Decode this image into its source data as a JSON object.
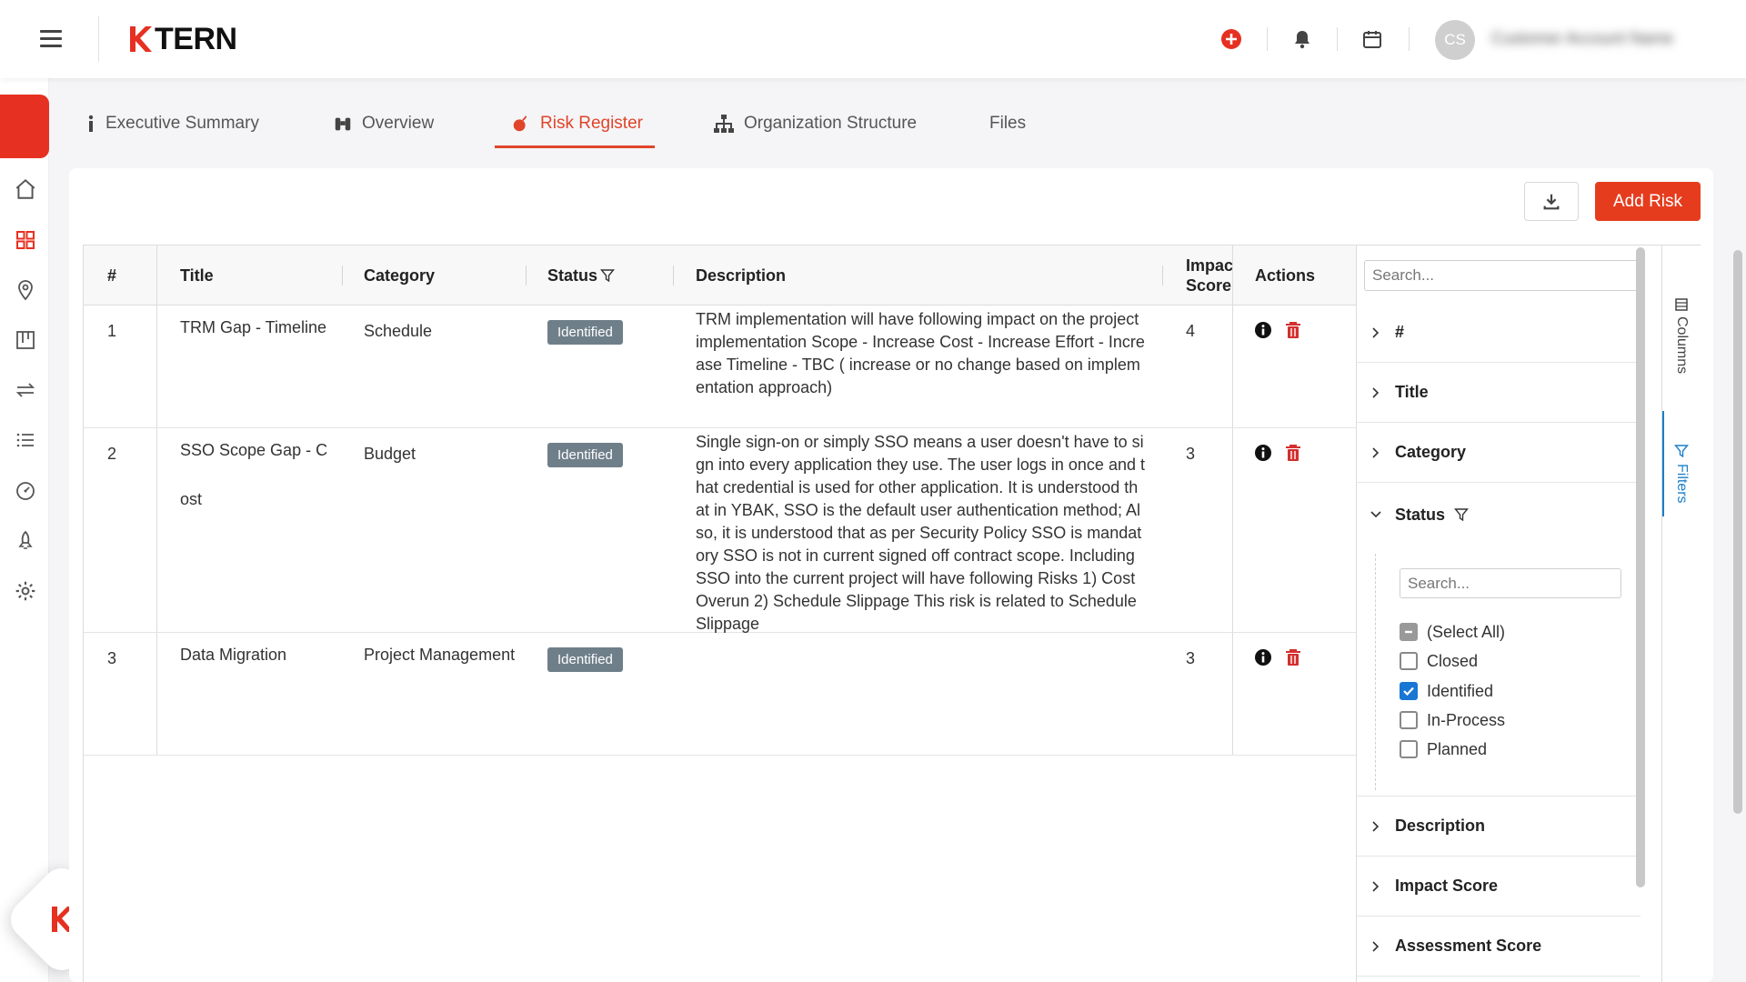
{
  "brand": {
    "name": "TERN",
    "accent": "#e63021"
  },
  "header": {
    "avatar_initials": "CS",
    "user_name": "Customer Account Name",
    "icons": [
      "add-circle-icon",
      "bell-icon",
      "calendar-icon"
    ]
  },
  "sidebar": {
    "items": [
      {
        "name": "home-icon"
      },
      {
        "name": "dashboard-grid-icon",
        "active": true
      },
      {
        "name": "location-pin-icon"
      },
      {
        "name": "kanban-board-icon"
      },
      {
        "name": "transfer-arrows-icon"
      },
      {
        "name": "list-icon"
      },
      {
        "name": "speedometer-icon"
      },
      {
        "name": "rocket-icon"
      },
      {
        "name": "settings-gear-icon"
      }
    ]
  },
  "tabs": [
    {
      "label": "Executive Summary",
      "icon": "info-icon"
    },
    {
      "label": "Overview",
      "icon": "binoculars-icon"
    },
    {
      "label": "Risk Register",
      "icon": "bomb-icon",
      "active": true
    },
    {
      "label": "Organization Structure",
      "icon": "org-chart-icon"
    },
    {
      "label": "Files",
      "icon": ""
    }
  ],
  "toolbar": {
    "add_label": "Add Risk"
  },
  "grid": {
    "columns": {
      "num": "#",
      "title": "Title",
      "category": "Category",
      "status": "Status",
      "description": "Description",
      "impact": "Impac Score",
      "actions": "Actions"
    },
    "rows": [
      {
        "num": "1",
        "title": "TRM Gap - Timeline",
        "category": "Schedule",
        "status": "Identified",
        "description": "TRM implementation will have following impact on the project implementation Scope - Increase Cost - Increase Effort - Increase Timeline - TBC ( increase or no change based on implementation approach)",
        "impact": "4"
      },
      {
        "num": "2",
        "title": "SSO Scope Gap - Cost",
        "category": "Budget",
        "status": "Identified",
        "description": "Single sign-on or simply SSO means a user doesn't have to sign into every application they use. The user logs in once and that credential is used for other application. It is understood that in YBAK, SSO is the default user authentication method; Also, it is understood that as per Security Policy SSO is mandatory SSO is not in current signed off contract scope. Including SSO into the current project will have following Risks 1) Cost Overun 2) Schedule Slippage This risk is related to Schedule Slippage",
        "impact": "3"
      },
      {
        "num": "3",
        "title": "Data Migration",
        "category": "Project Management",
        "status": "Identified",
        "description": "",
        "impact": "3"
      }
    ]
  },
  "filter_panel": {
    "search_placeholder": "Search...",
    "groups": [
      "#",
      "Title",
      "Category",
      "Status",
      "Description",
      "Impact Score",
      "Assessment Score"
    ],
    "status_filter": {
      "search_placeholder": "Search...",
      "options": [
        {
          "label": "(Select All)",
          "state": "indeterminate"
        },
        {
          "label": "Closed",
          "state": "unchecked"
        },
        {
          "label": "Identified",
          "state": "checked"
        },
        {
          "label": "In-Process",
          "state": "unchecked"
        },
        {
          "label": "Planned",
          "state": "unchecked"
        }
      ]
    }
  },
  "side_tabs": {
    "columns": "Columns",
    "filters": "Filters"
  }
}
